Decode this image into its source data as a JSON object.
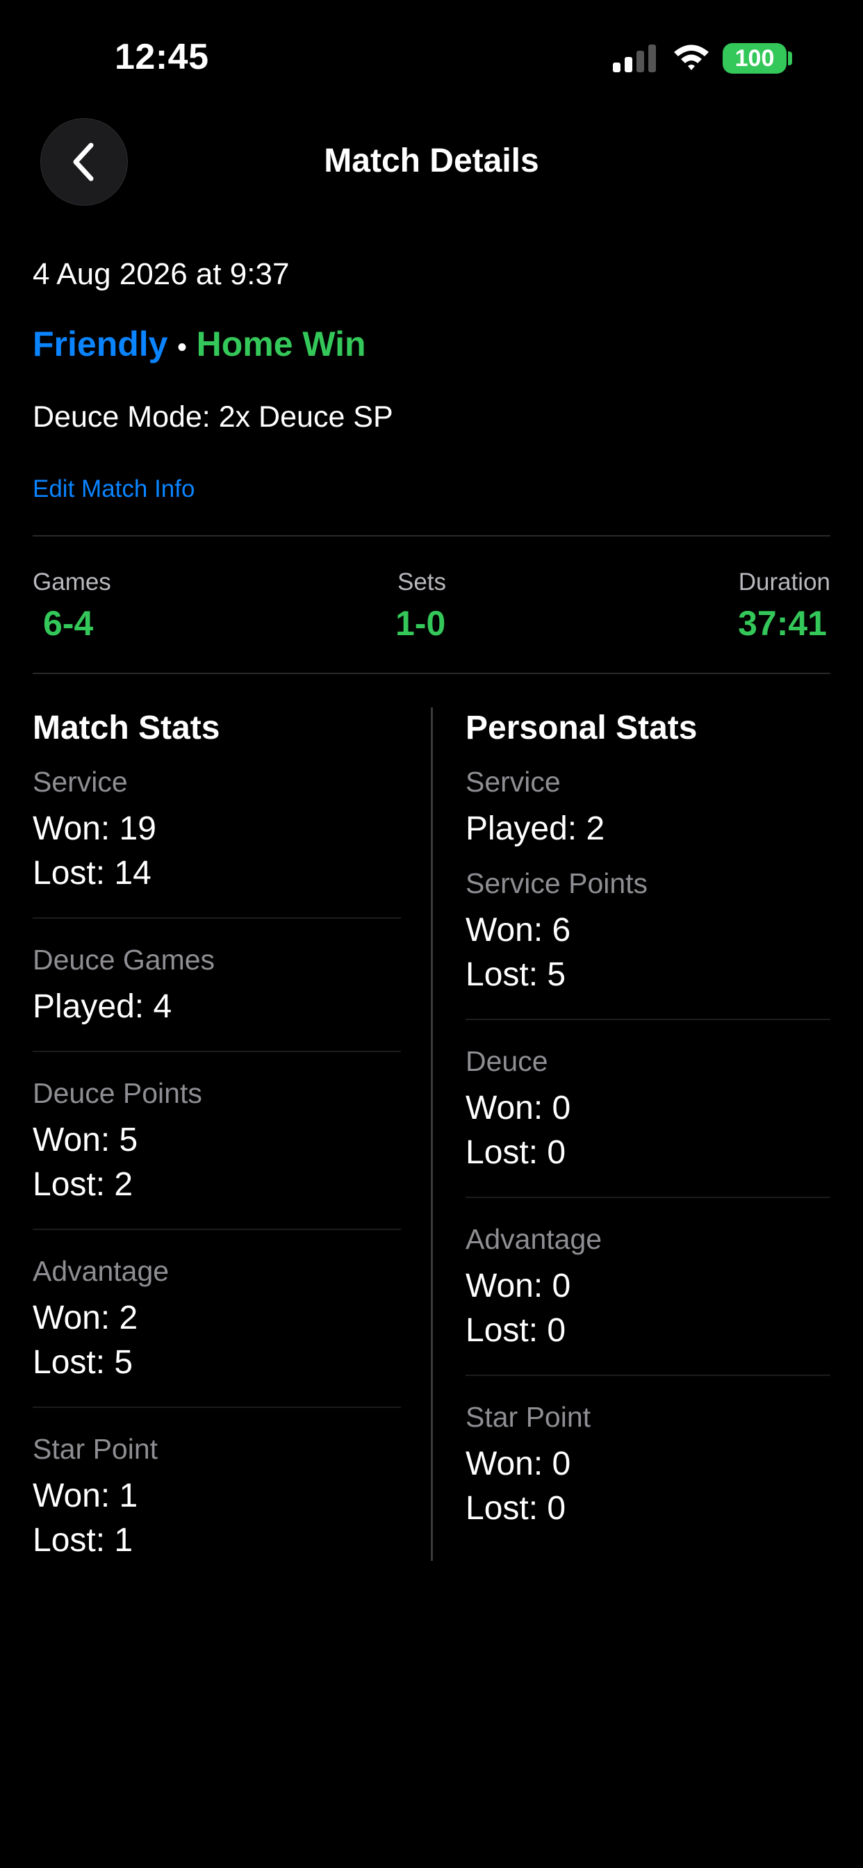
{
  "status_bar": {
    "time": "12:45",
    "battery": "100"
  },
  "nav": {
    "title": "Match Details"
  },
  "match": {
    "date": "4 Aug 2026 at 9:37",
    "type": "Friendly",
    "bullet": "•",
    "result": "Home Win",
    "deuce_mode": "Deuce Mode: 2x Deuce SP",
    "edit_label": "Edit Match Info"
  },
  "summary": {
    "games_label": "Games",
    "games_value": "6-4",
    "sets_label": "Sets",
    "sets_value": "1-0",
    "duration_label": "Duration",
    "duration_value": "37:41"
  },
  "match_stats": {
    "title": "Match Stats",
    "service": {
      "label": "Service",
      "won": "Won: 19",
      "lost": "Lost: 14"
    },
    "deuce_games": {
      "label": "Deuce Games",
      "played": "Played: 4"
    },
    "deuce_points": {
      "label": "Deuce Points",
      "won": "Won: 5",
      "lost": "Lost: 2"
    },
    "advantage": {
      "label": "Advantage",
      "won": "Won: 2",
      "lost": "Lost: 5"
    },
    "star_point": {
      "label": "Star Point",
      "won": "Won: 1",
      "lost": "Lost: 1"
    }
  },
  "personal_stats": {
    "title": "Personal Stats",
    "service": {
      "label": "Service",
      "played": "Played: 2"
    },
    "service_points": {
      "label": "Service Points",
      "won": "Won: 6",
      "lost": "Lost: 5"
    },
    "deuce": {
      "label": "Deuce",
      "won": "Won: 0",
      "lost": "Lost: 0"
    },
    "advantage": {
      "label": "Advantage",
      "won": "Won: 0",
      "lost": "Lost: 0"
    },
    "star_point": {
      "label": "Star Point",
      "won": "Won: 0",
      "lost": "Lost: 0"
    }
  },
  "colors": {
    "accent_blue": "#0A84FF",
    "accent_green": "#34C759"
  }
}
